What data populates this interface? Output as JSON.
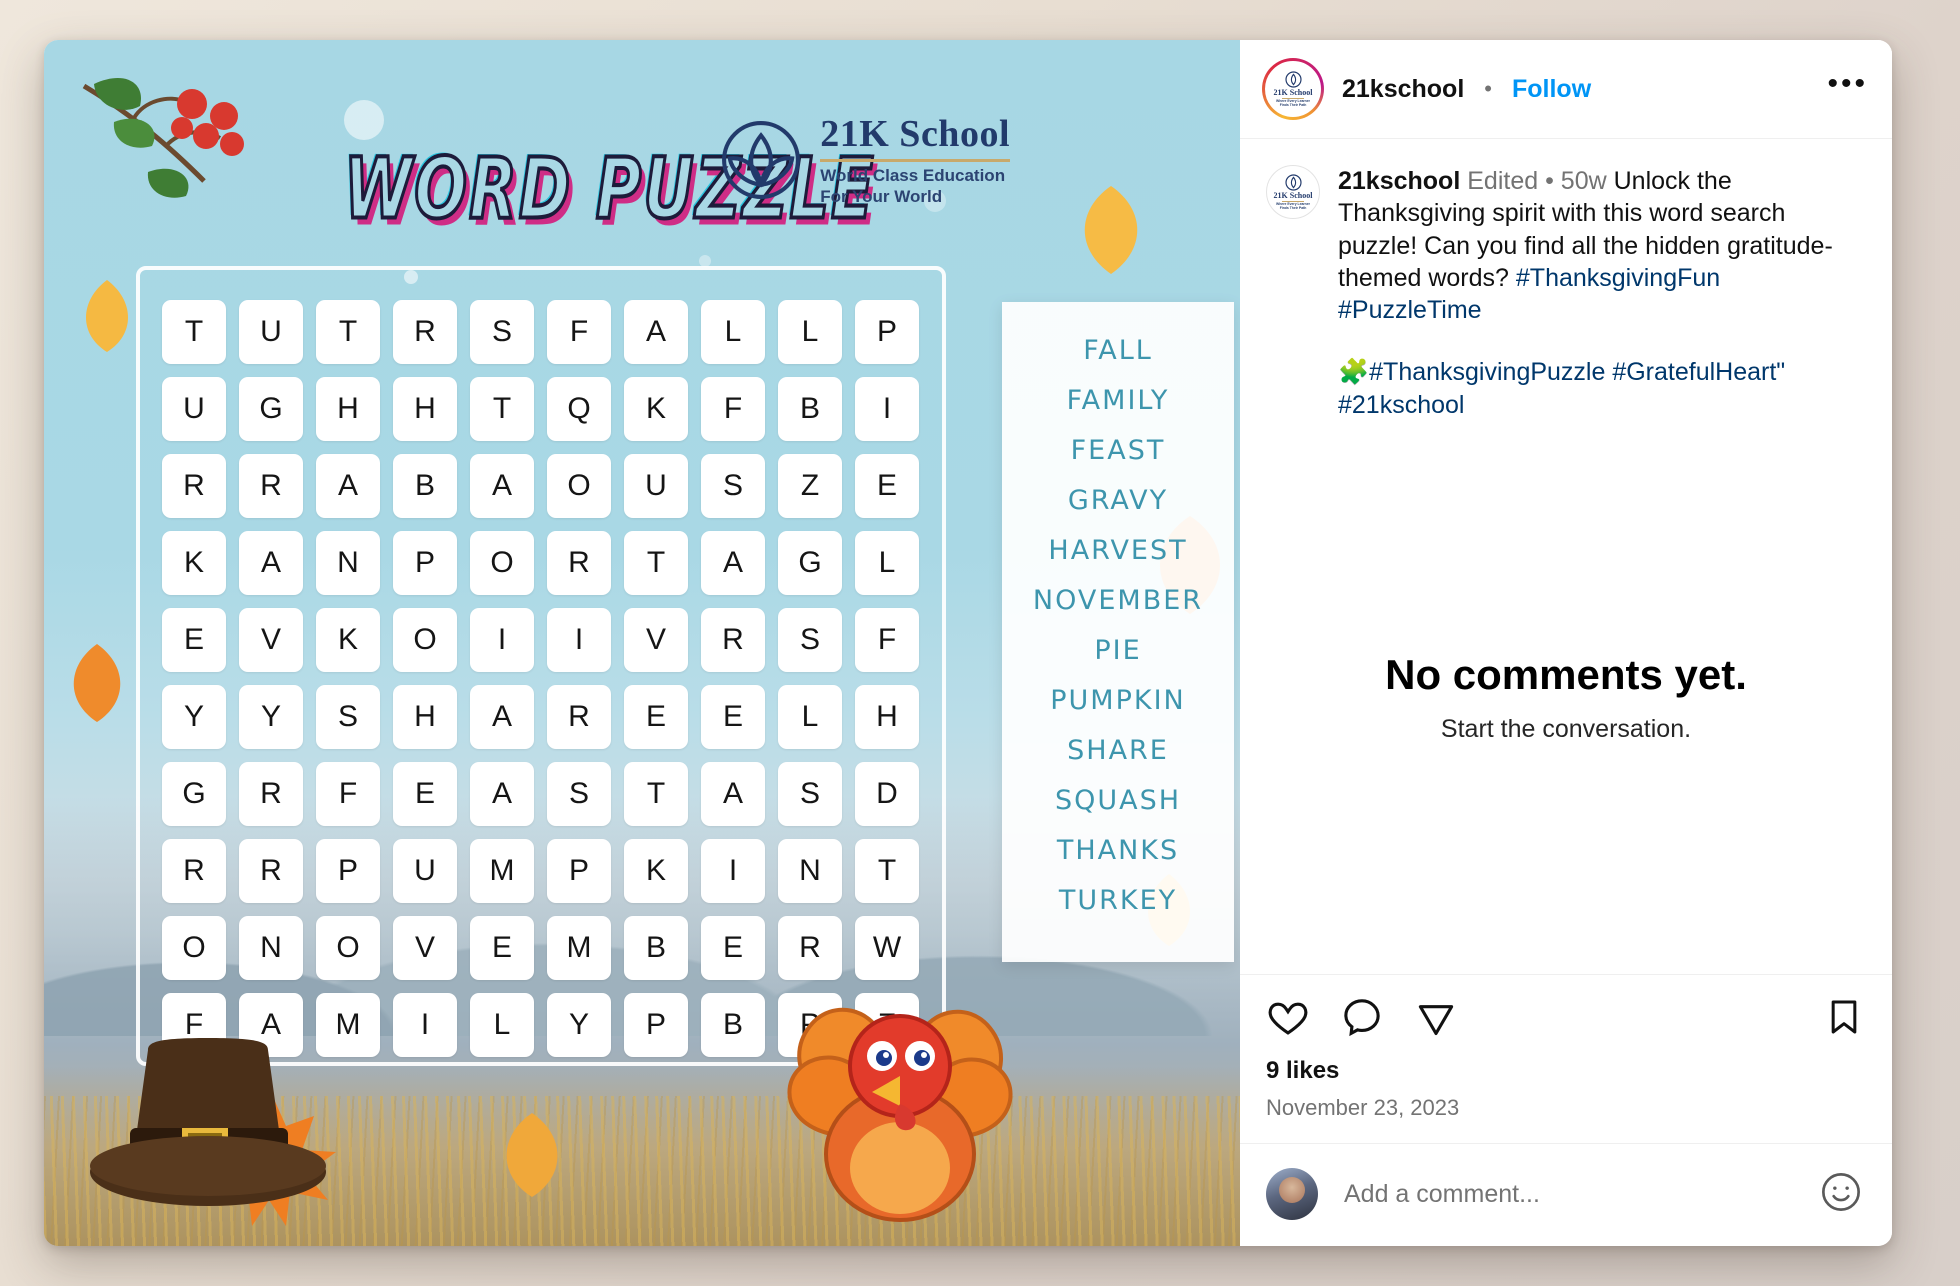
{
  "post": {
    "header": {
      "username": "21kschool",
      "separator": "•",
      "follow_label": "Follow",
      "more_label": "•••"
    },
    "caption": {
      "username": "21kschool",
      "edited_label": "Edited",
      "separator": "•",
      "age": "50w",
      "text": "Unlock the Thanksgiving spirit with this word search puzzle! Can you find all the hidden gratitude-themed words?",
      "hashtags_line1": "#ThanksgivingFun #PuzzleTime",
      "emoji": "🧩",
      "hashtags_line2": "#ThanksgivingPuzzle #GratefulHeart\"",
      "hashtags_line3": "#21kschool"
    },
    "comments": {
      "empty_title": "No comments yet.",
      "empty_subtitle": "Start the conversation."
    },
    "actions": {
      "like_icon": "heart-icon",
      "comment_icon": "comment-icon",
      "share_icon": "share-icon",
      "save_icon": "bookmark-icon",
      "likes": "9 likes",
      "date": "November 23, 2023"
    },
    "add_comment": {
      "placeholder": "Add a comment...",
      "emoji_icon": "emoji-icon"
    }
  },
  "media": {
    "title": "WORD PUZZLE",
    "brand": {
      "name": "21K School",
      "tagline_line1": "World Class Education",
      "tagline_line2": "For Your World"
    },
    "grid": {
      "rows": [
        [
          "T",
          "U",
          "T",
          "R",
          "S",
          "F",
          "A",
          "L",
          "L",
          "P"
        ],
        [
          "U",
          "G",
          "H",
          "H",
          "T",
          "Q",
          "K",
          "F",
          "B",
          "I"
        ],
        [
          "R",
          "R",
          "A",
          "B",
          "A",
          "O",
          "U",
          "S",
          "Z",
          "E"
        ],
        [
          "K",
          "A",
          "N",
          "P",
          "O",
          "R",
          "T",
          "A",
          "G",
          "L"
        ],
        [
          "E",
          "V",
          "K",
          "O",
          "I",
          "I",
          "V",
          "R",
          "S",
          "F"
        ],
        [
          "Y",
          "Y",
          "S",
          "H",
          "A",
          "R",
          "E",
          "E",
          "L",
          "H"
        ],
        [
          "G",
          "R",
          "F",
          "E",
          "A",
          "S",
          "T",
          "A",
          "S",
          "D"
        ],
        [
          "R",
          "R",
          "P",
          "U",
          "M",
          "P",
          "K",
          "I",
          "N",
          "T"
        ],
        [
          "O",
          "N",
          "O",
          "V",
          "E",
          "M",
          "B",
          "E",
          "R",
          "W"
        ],
        [
          "F",
          "A",
          "M",
          "I",
          "L",
          "Y",
          "P",
          "B",
          "P",
          "Z"
        ]
      ]
    },
    "words": [
      "FALL",
      "FAMILY",
      "FEAST",
      "GRAVY",
      "HARVEST",
      "NOVEMBER",
      "PIE",
      "PUMPKIN",
      "SHARE",
      "SQUASH",
      "THANKS",
      "TURKEY"
    ]
  },
  "colors": {
    "link": "#0095f6",
    "hashtag": "#00376b",
    "word_list": "#3d95ad",
    "brand_navy": "#223a6b",
    "puzzle_bg": "#a9d8e5"
  }
}
